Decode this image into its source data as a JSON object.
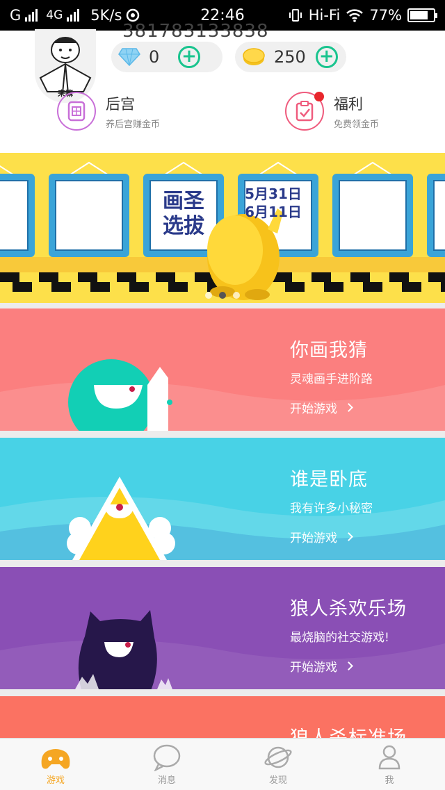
{
  "status_bar": {
    "carrier": "G",
    "network": "4G",
    "speed": "5K/s",
    "time": "22:46",
    "wifi_label": "Hi-Fi",
    "battery": "77%",
    "battery_level": 0.77
  },
  "profile": {
    "user_id": "381783133838",
    "avatar_caption": "来嘛",
    "diamonds": "0",
    "coins": "250"
  },
  "quick_links": [
    {
      "title": "后宫",
      "subtitle": "养后宫赚金币",
      "icon": "palace-icon",
      "badge": false
    },
    {
      "title": "福利",
      "subtitle": "免费领金币",
      "icon": "clipboard-icon",
      "badge": true
    }
  ],
  "banner": {
    "frames": [
      "",
      "",
      "画圣\n选拔",
      "5月31日\n6月11日",
      "",
      ""
    ],
    "page_count": 3,
    "active_page": 2
  },
  "games": [
    {
      "title": "你画我猜",
      "subtitle": "灵魂画手进阶路",
      "action": "开始游戏",
      "color": "#fb7f7f"
    },
    {
      "title": "谁是卧底",
      "subtitle": "我有许多小秘密",
      "action": "开始游戏",
      "color": "#48d2e6"
    },
    {
      "title": "狼人杀欢乐场",
      "subtitle": "最烧脑的社交游戏!",
      "action": "开始游戏",
      "color": "#8a4fb5"
    },
    {
      "title": "狼人杀标准场",
      "subtitle": "",
      "action": "",
      "color": "#fb7262"
    }
  ],
  "tabs": [
    {
      "label": "游戏",
      "icon": "gamepad-icon",
      "active": true
    },
    {
      "label": "消息",
      "icon": "chat-bubble-icon",
      "active": false
    },
    {
      "label": "发现",
      "icon": "planet-icon",
      "active": false
    },
    {
      "label": "我",
      "icon": "person-icon",
      "active": false
    }
  ],
  "colors": {
    "accent_green": "#19c48e",
    "tab_active": "#f5a623",
    "banner_yellow": "#fde04a"
  }
}
